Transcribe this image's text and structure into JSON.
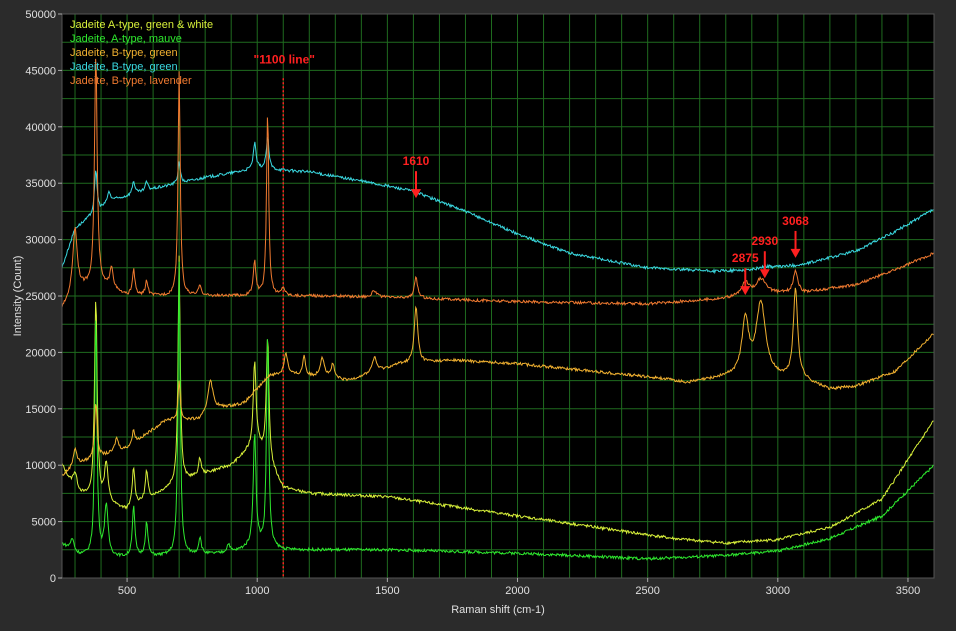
{
  "chart_data": {
    "type": "line",
    "xlabel": "Raman shift (cm-1)",
    "ylabel": "Intensity (Count)",
    "xlim": [
      250,
      3600
    ],
    "ylim": [
      0,
      50000
    ],
    "xticks": [
      500,
      1000,
      1500,
      2000,
      2500,
      3000,
      3500
    ],
    "yticks": [
      0,
      5000,
      10000,
      15000,
      20000,
      25000,
      30000,
      35000,
      40000,
      45000,
      50000
    ],
    "grid": true,
    "legend_position": "top-left",
    "background": "#000000",
    "grid_color": "#1f6b1f",
    "series": [
      {
        "name": "Jadeite A-type, green & white",
        "color": "#d8f03a",
        "baseline": [
          [
            250,
            10000
          ],
          [
            300,
            7500
          ],
          [
            500,
            6000
          ],
          [
            700,
            8500
          ],
          [
            900,
            10000
          ],
          [
            1000,
            12000
          ],
          [
            1100,
            8000
          ],
          [
            1200,
            7500
          ],
          [
            1500,
            7200
          ],
          [
            2000,
            5500
          ],
          [
            2300,
            4500
          ],
          [
            2600,
            3500
          ],
          [
            2800,
            3100
          ],
          [
            3000,
            3400
          ],
          [
            3200,
            4500
          ],
          [
            3400,
            7000
          ],
          [
            3600,
            14000
          ]
        ],
        "peaks": [
          [
            300,
            1800,
            10
          ],
          [
            380,
            18000,
            6
          ],
          [
            420,
            3500,
            8
          ],
          [
            525,
            3500,
            6
          ],
          [
            575,
            2500,
            6
          ],
          [
            700,
            20000,
            5
          ],
          [
            780,
            1500,
            6
          ],
          [
            990,
            7500,
            6
          ],
          [
            1040,
            11000,
            6
          ]
        ]
      },
      {
        "name": "Jadeite, A-type, mauve",
        "color": "#2ee82e",
        "baseline": [
          [
            250,
            3000
          ],
          [
            300,
            2000
          ],
          [
            500,
            1800
          ],
          [
            700,
            2000
          ],
          [
            900,
            2200
          ],
          [
            1000,
            3000
          ],
          [
            1100,
            2500
          ],
          [
            1200,
            2500
          ],
          [
            1500,
            2500
          ],
          [
            2000,
            2200
          ],
          [
            2500,
            1700
          ],
          [
            2800,
            2000
          ],
          [
            3000,
            2400
          ],
          [
            3200,
            3500
          ],
          [
            3400,
            5500
          ],
          [
            3600,
            10000
          ]
        ],
        "peaks": [
          [
            290,
            1200,
            10
          ],
          [
            380,
            21500,
            5
          ],
          [
            420,
            4500,
            8
          ],
          [
            525,
            4500,
            6
          ],
          [
            575,
            3000,
            6
          ],
          [
            700,
            26000,
            5
          ],
          [
            780,
            1500,
            6
          ],
          [
            890,
            800,
            8
          ],
          [
            990,
            10000,
            6
          ],
          [
            1040,
            19000,
            5
          ]
        ]
      },
      {
        "name": "Jadeite, B-type, green",
        "color": "#f0b030",
        "baseline": [
          [
            250,
            9000
          ],
          [
            300,
            10000
          ],
          [
            500,
            11500
          ],
          [
            650,
            14000
          ],
          [
            780,
            14000
          ],
          [
            850,
            15000
          ],
          [
            950,
            15500
          ],
          [
            1050,
            18000
          ],
          [
            1150,
            18000
          ],
          [
            1350,
            17500
          ],
          [
            1550,
            19000
          ],
          [
            1750,
            19300
          ],
          [
            2000,
            19000
          ],
          [
            2300,
            18300
          ],
          [
            2550,
            17700
          ],
          [
            2650,
            17300
          ],
          [
            2800,
            17800
          ],
          [
            2870,
            17900
          ],
          [
            3100,
            17500
          ],
          [
            3200,
            16700
          ],
          [
            3300,
            17000
          ],
          [
            3450,
            18300
          ],
          [
            3600,
            21700
          ]
        ],
        "peaks": [
          [
            300,
            1500,
            8
          ],
          [
            380,
            5000,
            6
          ],
          [
            460,
            1200,
            8
          ],
          [
            525,
            1200,
            6
          ],
          [
            700,
            3500,
            5
          ],
          [
            820,
            3000,
            12
          ],
          [
            1110,
            2000,
            8
          ],
          [
            1180,
            1800,
            6
          ],
          [
            1250,
            1800,
            10
          ],
          [
            1290,
            1200,
            8
          ],
          [
            1450,
            1300,
            10
          ],
          [
            1610,
            5000,
            8
          ],
          [
            2875,
            4900,
            15
          ],
          [
            2935,
            6500,
            22
          ],
          [
            3068,
            8000,
            10
          ]
        ]
      },
      {
        "name": "Jadeite, B-type, green",
        "color": "#3ad8e0",
        "baseline": [
          [
            250,
            27500
          ],
          [
            300,
            31000
          ],
          [
            450,
            33500
          ],
          [
            600,
            34500
          ],
          [
            800,
            35500
          ],
          [
            1000,
            36300
          ],
          [
            1200,
            36000
          ],
          [
            1400,
            35200
          ],
          [
            1600,
            34300
          ],
          [
            1800,
            32500
          ],
          [
            2000,
            30500
          ],
          [
            2200,
            28800
          ],
          [
            2500,
            27500
          ],
          [
            2750,
            27200
          ],
          [
            2900,
            27300
          ],
          [
            3100,
            27800
          ],
          [
            3300,
            29000
          ],
          [
            3450,
            30700
          ],
          [
            3600,
            32700
          ]
        ],
        "peaks": [
          [
            380,
            3800,
            6
          ],
          [
            430,
            1000,
            8
          ],
          [
            525,
            1200,
            6
          ],
          [
            575,
            800,
            6
          ],
          [
            700,
            2000,
            5
          ],
          [
            990,
            2300,
            6
          ],
          [
            1040,
            2800,
            6
          ],
          [
            2950,
            200,
            30
          ]
        ]
      },
      {
        "name": "Jadeite, B-type, lavender",
        "color": "#f07a30",
        "baseline": [
          [
            250,
            23800
          ],
          [
            300,
            25500
          ],
          [
            380,
            26000
          ],
          [
            500,
            25000
          ],
          [
            700,
            25000
          ],
          [
            1000,
            25000
          ],
          [
            1300,
            25000
          ],
          [
            1600,
            24800
          ],
          [
            2000,
            24500
          ],
          [
            2500,
            24300
          ],
          [
            2800,
            24800
          ],
          [
            2900,
            25200
          ],
          [
            3100,
            25300
          ],
          [
            3300,
            26000
          ],
          [
            3450,
            27300
          ],
          [
            3600,
            28800
          ]
        ],
        "peaks": [
          [
            300,
            5500,
            10
          ],
          [
            380,
            20500,
            6
          ],
          [
            440,
            2000,
            8
          ],
          [
            525,
            2300,
            6
          ],
          [
            575,
            1300,
            6
          ],
          [
            700,
            20000,
            5
          ],
          [
            780,
            1000,
            6
          ],
          [
            990,
            3000,
            6
          ],
          [
            1040,
            16500,
            5
          ],
          [
            1100,
            700,
            8
          ],
          [
            1450,
            600,
            10
          ],
          [
            1610,
            1800,
            8
          ],
          [
            2875,
            1100,
            15
          ],
          [
            2935,
            1300,
            22
          ],
          [
            3068,
            2000,
            10
          ]
        ]
      }
    ],
    "marker_line": {
      "x": 1100,
      "label": "\"1100 line\""
    },
    "annotations": [
      {
        "label": "1610",
        "x": 1610,
        "y": 36600
      },
      {
        "label": "2875",
        "x": 2875,
        "y": 28000
      },
      {
        "label": "2930",
        "x": 2950,
        "y": 29500
      },
      {
        "label": "3068",
        "x": 3068,
        "y": 31300
      }
    ],
    "annotation_color": "#ff2020"
  }
}
